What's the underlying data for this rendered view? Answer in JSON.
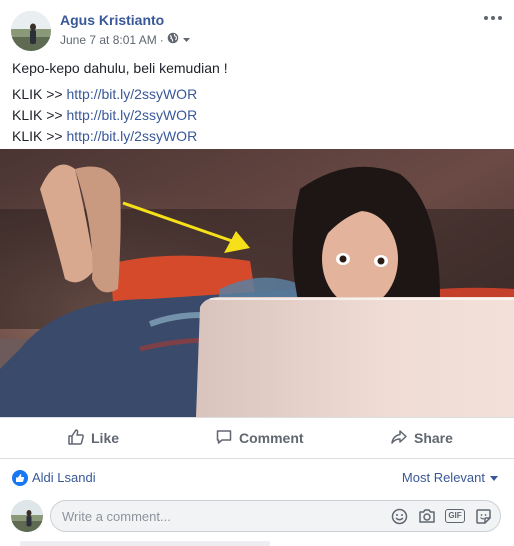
{
  "post": {
    "author": "Agus Kristianto",
    "date": "June 7 at 8:01 AM",
    "separator": "·",
    "text_line1": "Kepo-kepo dahulu, beli kemudian !",
    "links": [
      {
        "prefix": "KLIK >> ",
        "url": "http://bit.ly/2ssyWOR"
      },
      {
        "prefix": "KLIK >> ",
        "url": "http://bit.ly/2ssyWOR"
      },
      {
        "prefix": "KLIK >> ",
        "url": "http://bit.ly/2ssyWOR"
      }
    ]
  },
  "actions": {
    "like": "Like",
    "comment": "Comment",
    "share": "Share"
  },
  "reactions": {
    "likers": "Aldi Lsandi",
    "sort": "Most Relevant"
  },
  "comment_box": {
    "placeholder": "Write a comment...",
    "gif": "GIF"
  },
  "colors": {
    "link": "#385898",
    "secondary_text": "#606770",
    "like_blue": "#1877f2",
    "arrow_yellow": "#f5e01a"
  }
}
